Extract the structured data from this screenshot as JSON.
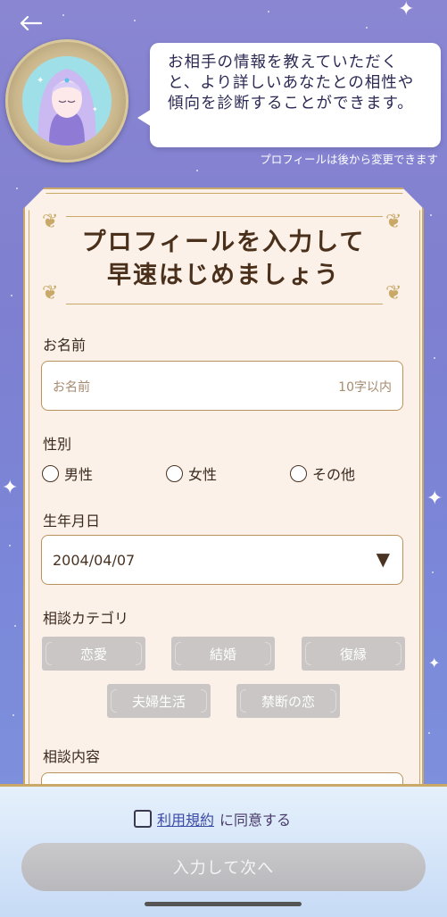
{
  "header": {
    "back_icon": "back-arrow-icon"
  },
  "speech": {
    "text": "お相手の情報を教えていただくと、より詳しいあなたとの相性や傾向を診断することができます。"
  },
  "note": "プロフィールは後から変更できます",
  "card": {
    "title_line1": "プロフィールを入力して",
    "title_line2": "早速はじめましょう"
  },
  "name": {
    "label": "お名前",
    "placeholder": "お名前",
    "limit": "10字以内"
  },
  "gender": {
    "label": "性別",
    "options": [
      "男性",
      "女性",
      "その他"
    ]
  },
  "birth": {
    "label": "生年月日",
    "value": "2004/04/07",
    "icon": "dropdown-triangle-icon"
  },
  "category": {
    "label": "相談カテゴリ",
    "items": [
      "恋愛",
      "結婚",
      "復縁",
      "夫婦生活",
      "禁断の恋"
    ]
  },
  "content": {
    "label": "相談内容"
  },
  "footer": {
    "terms_link": "利用規約",
    "terms_suffix": "に同意する",
    "next_button": "入力して次へ"
  }
}
